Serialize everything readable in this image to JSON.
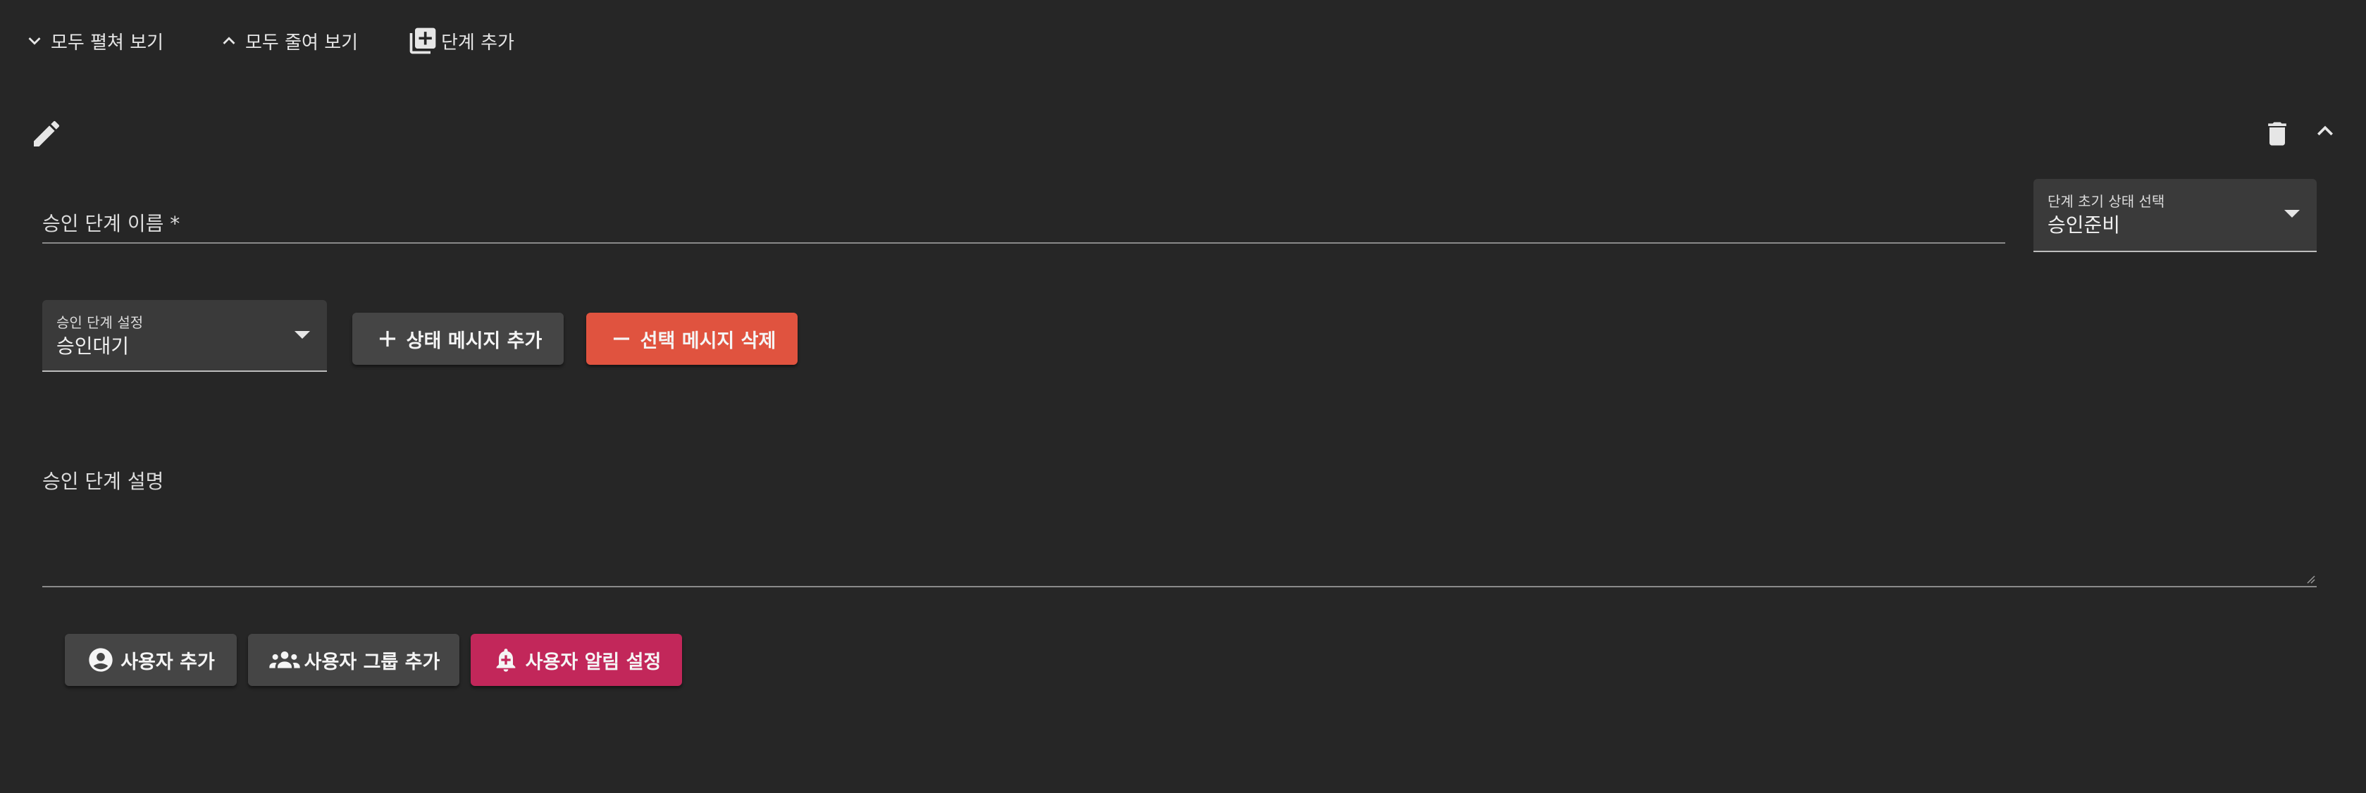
{
  "toolbar": {
    "expand_all_label": "모두 펼쳐 보기",
    "collapse_all_label": "모두 줄여 보기",
    "add_step_label": "단계 추가"
  },
  "step": {
    "name_field": {
      "label": "승인 단계 이름 *",
      "value": ""
    },
    "initial_status_select": {
      "label": "단계 초기 상태 선택",
      "value": "승인준비"
    },
    "step_setting_select": {
      "label": "승인 단계 설정",
      "value": "승인대기"
    },
    "add_status_message_label": "상태 메시지 추가",
    "delete_selected_message_label": "선택 메시지 삭제",
    "description_field": {
      "label": "승인 단계 설명",
      "value": ""
    },
    "add_user_label": "사용자 추가",
    "add_user_group_label": "사용자 그룹 추가",
    "user_notification_label": "사용자 알림 설정"
  },
  "icons": {
    "expand": "chevron-down-icon",
    "collapse": "chevron-up-icon",
    "add_step": "library-add-icon",
    "edit": "pencil-icon",
    "delete": "trash-icon",
    "collapse_step": "chevron-up-icon",
    "add": "plus-icon",
    "remove": "minus-icon",
    "user": "account-circle-icon",
    "user_group": "account-group-icon",
    "notification": "bell-plus-icon"
  },
  "colors": {
    "background": "#262626",
    "dark_button": "#454545",
    "delete_button": "#e0533f",
    "notification_button": "#c2275a",
    "select_background": "#3a3a3a"
  }
}
